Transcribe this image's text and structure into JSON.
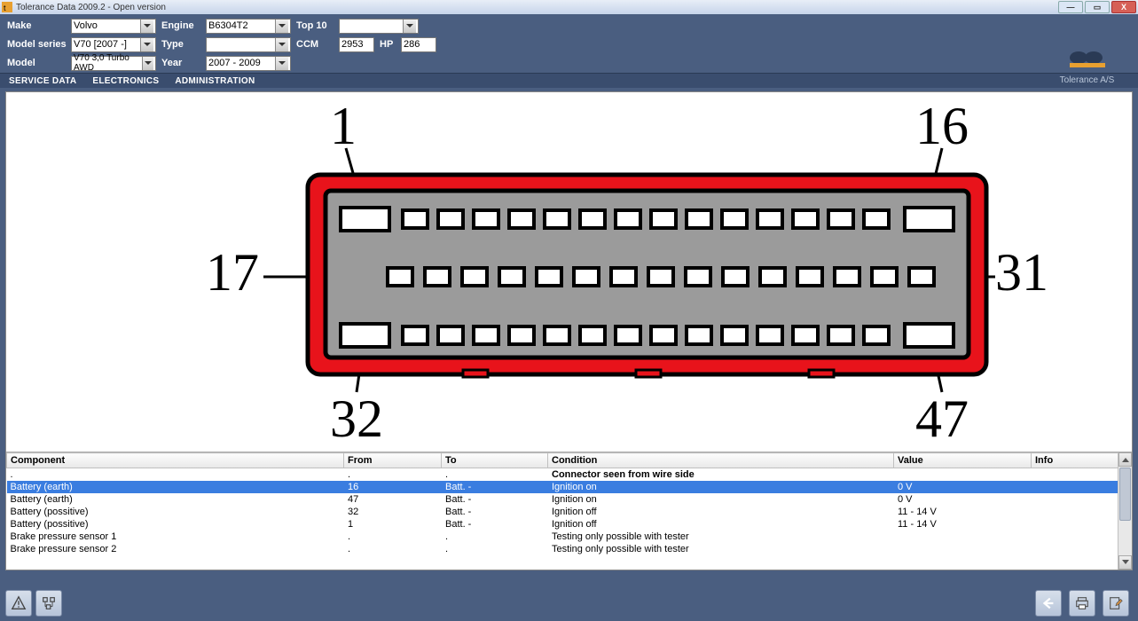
{
  "window": {
    "title": "Tolerance Data 2009.2 - Open version"
  },
  "form": {
    "make": {
      "label": "Make",
      "value": "Volvo"
    },
    "model_series": {
      "label": "Model series",
      "value": "V70 [2007 -]"
    },
    "model": {
      "label": "Model",
      "value": "V70 3,0 Turbo AWD"
    },
    "engine": {
      "label": "Engine",
      "value": "B6304T2"
    },
    "type": {
      "label": "Type",
      "value": ""
    },
    "year": {
      "label": "Year",
      "value": "2007 - 2009"
    },
    "top10": {
      "label": "Top 10",
      "value": ""
    },
    "ccm": {
      "label": "CCM",
      "value": "2953"
    },
    "hp": {
      "label": "HP",
      "value": "286"
    }
  },
  "brand": "Tolerance A/S",
  "menu": {
    "service_data": "SERVICE DATA",
    "electronics": "ELECTRONICS",
    "administration": "ADMINISTRATION"
  },
  "diagram": {
    "labels": {
      "pin1": "1",
      "pin16": "16",
      "pin17": "17",
      "pin31": "31",
      "pin32": "32",
      "pin47": "47"
    }
  },
  "table": {
    "headers": {
      "component": "Component",
      "from": "From",
      "to": "To",
      "condition": "Condition",
      "value": "Value",
      "info": "Info"
    },
    "subheader": {
      "component": ".",
      "from": ".",
      "to": ".",
      "condition": "Connector seen from wire side",
      "value": "",
      "info": ""
    },
    "rows": [
      {
        "component": "Battery (earth)",
        "from": "16",
        "to": "Batt. -",
        "condition": "Ignition on",
        "value": "0 V",
        "info": ""
      },
      {
        "component": "Battery (earth)",
        "from": "47",
        "to": "Batt. -",
        "condition": "Ignition on",
        "value": "0 V",
        "info": ""
      },
      {
        "component": "Battery (possitive)",
        "from": "32",
        "to": "Batt. -",
        "condition": "Ignition off",
        "value": "11 - 14 V",
        "info": ""
      },
      {
        "component": "Battery (possitive)",
        "from": "1",
        "to": "Batt. -",
        "condition": "Ignition off",
        "value": "11 - 14 V",
        "info": ""
      },
      {
        "component": "Brake pressure sensor 1",
        "from": ".",
        "to": ".",
        "condition": "Testing only possible with tester",
        "value": "",
        "info": ""
      },
      {
        "component": "Brake pressure sensor 2",
        "from": ".",
        "to": ".",
        "condition": "Testing only possible with tester",
        "value": "",
        "info": ""
      }
    ]
  }
}
